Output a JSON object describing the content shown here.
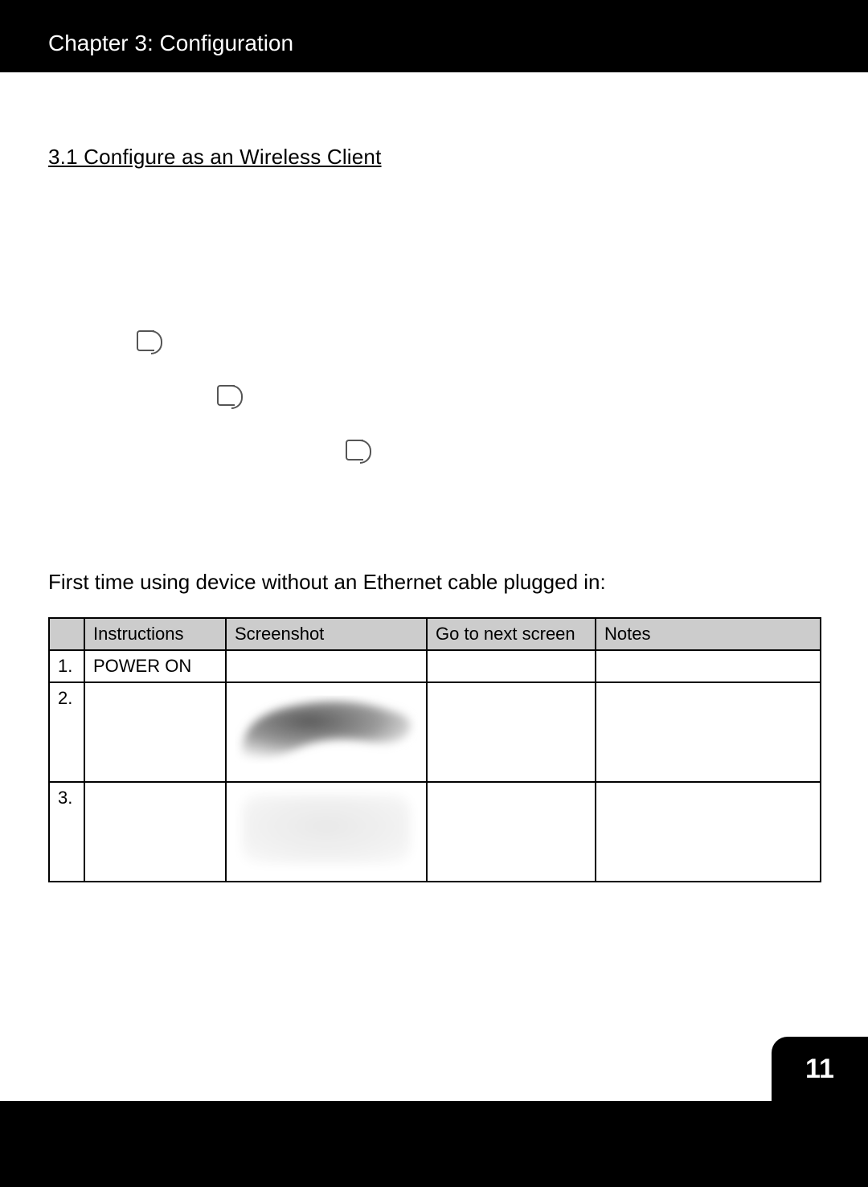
{
  "header": {
    "chapter_title": "Chapter 3: Configuration"
  },
  "section": {
    "heading": "3.1 Configure as an Wireless Client   "
  },
  "intro": "First time using device without an Ethernet cable plugged in:",
  "table": {
    "headers": {
      "num": "",
      "instructions": "Instructions",
      "screenshot": "Screenshot",
      "go_next": "Go to next screen",
      "notes": "Notes"
    },
    "rows": [
      {
        "num": "1.",
        "instructions": "POWER ON",
        "screenshot": "",
        "go_next": "",
        "notes": ""
      },
      {
        "num": "2.",
        "instructions": "",
        "screenshot": "",
        "go_next": "",
        "notes": ""
      },
      {
        "num": "3.",
        "instructions": "",
        "screenshot": "",
        "go_next": "",
        "notes": ""
      }
    ]
  },
  "page_number": "11"
}
